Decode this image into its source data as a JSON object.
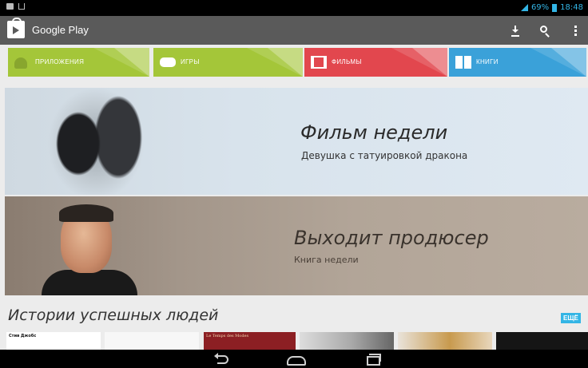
{
  "status_bar": {
    "battery": "69%",
    "time": "18:48",
    "icons": [
      "notification-icon",
      "usb-icon",
      "signal-icon",
      "battery-icon"
    ]
  },
  "action_bar": {
    "title": "Google Play",
    "icons": [
      "play-store-icon",
      "download-icon",
      "search-icon",
      "overflow-menu-icon"
    ]
  },
  "categories": [
    {
      "label": "ПРИЛОЖЕНИЯ",
      "color": "#a4c639",
      "icon": "android-icon"
    },
    {
      "label": "ИГРЫ",
      "color": "#a4c639",
      "icon": "gamepad-icon"
    },
    {
      "label": "ФИЛЬМЫ",
      "color": "#e2474e",
      "icon": "film-icon"
    },
    {
      "label": "КНИГИ",
      "color": "#3aa1d9",
      "icon": "book-icon"
    }
  ],
  "featured_movie": {
    "heading": "Фильм недели",
    "title": "Девушка с татуировкой дракона"
  },
  "featured_book": {
    "heading": "Выходит продюсер",
    "subtitle": "Книга недели"
  },
  "section": {
    "title": "Истории успешных людей",
    "more_label": "ЕЩЁ",
    "books": [
      {
        "label": "Стив Джобс"
      },
      {
        "label": ""
      },
      {
        "label": "Le Temps des Modes"
      },
      {
        "label": ""
      },
      {
        "label": ""
      },
      {
        "label": ""
      }
    ]
  },
  "nav_bar": {
    "icons": [
      "back-icon",
      "home-icon",
      "recent-apps-icon"
    ]
  },
  "colors": {
    "accent": "#33b5e5",
    "action_bar": "#5a5a5a",
    "background": "#ececec"
  }
}
